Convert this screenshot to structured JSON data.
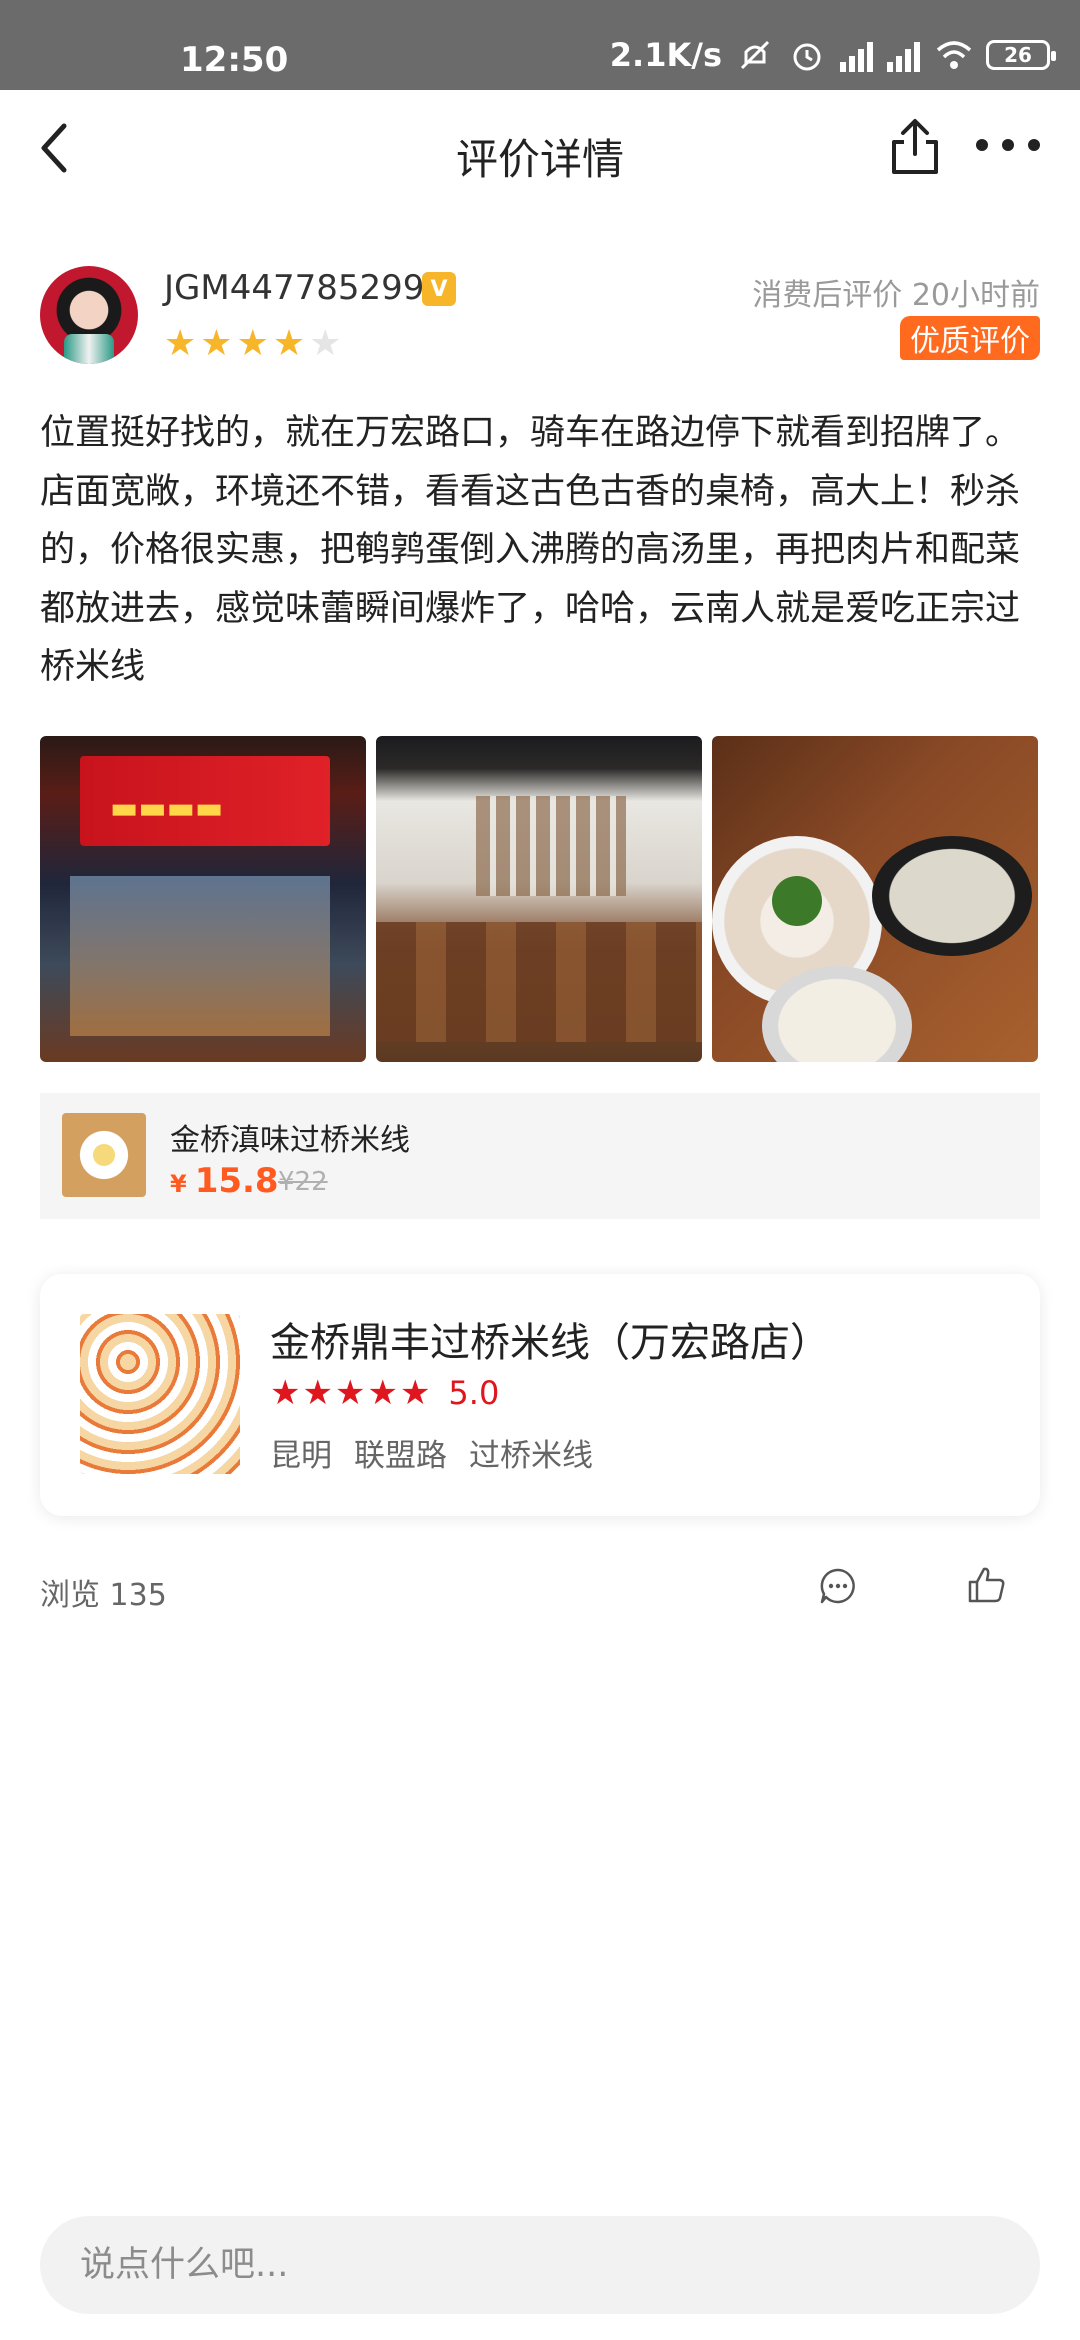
{
  "status_bar": {
    "time": "12:50",
    "speed": "2.1K/s",
    "battery": "26",
    "icons": [
      "mute-icon",
      "alarm-icon",
      "signal-icon",
      "signal-icon",
      "wifi-icon",
      "battery-icon"
    ]
  },
  "header": {
    "title": "评价详情",
    "icons": [
      "back-icon",
      "share-icon",
      "more-icon"
    ]
  },
  "review": {
    "username": "JGM447785299",
    "vip_badge": "V",
    "rating_stars": 4,
    "rating_max": 5,
    "meta": "消费后评价  20小时前",
    "quality_badge": "优质评价",
    "text": "位置挺好找的，就在万宏路口，骑车在路边停下就看到招牌了。店面宽敞，环境还不错，看看这古色古香的桌椅，高大上！秒杀的，价格很实惠，把鹌鹑蛋倒入沸腾的高汤里，再把肉片和配菜都放进去，感觉味蕾瞬间爆炸了，哈哈，云南人就是爱吃正宗过桥米线"
  },
  "photos": [
    {
      "name": "photo-storefront"
    },
    {
      "name": "photo-interior"
    },
    {
      "name": "photo-dish"
    }
  ],
  "dish": {
    "name": "金桥滇味过桥米线",
    "currency": "¥",
    "price": "15.8",
    "original_price": "¥22"
  },
  "shop": {
    "name": "金桥鼎丰过桥米线（万宏路店）",
    "stars": 5,
    "score": "5.0",
    "tags": [
      "昆明",
      "联盟路",
      "过桥米线"
    ]
  },
  "stats": {
    "views": "浏览 135"
  },
  "comment_box": {
    "placeholder": "说点什么吧..."
  },
  "colors": {
    "accent": "#ff5a1f",
    "star_user": "#f7b52a",
    "star_shop": "#e0161e",
    "status_bar": "#6b6b6b"
  }
}
